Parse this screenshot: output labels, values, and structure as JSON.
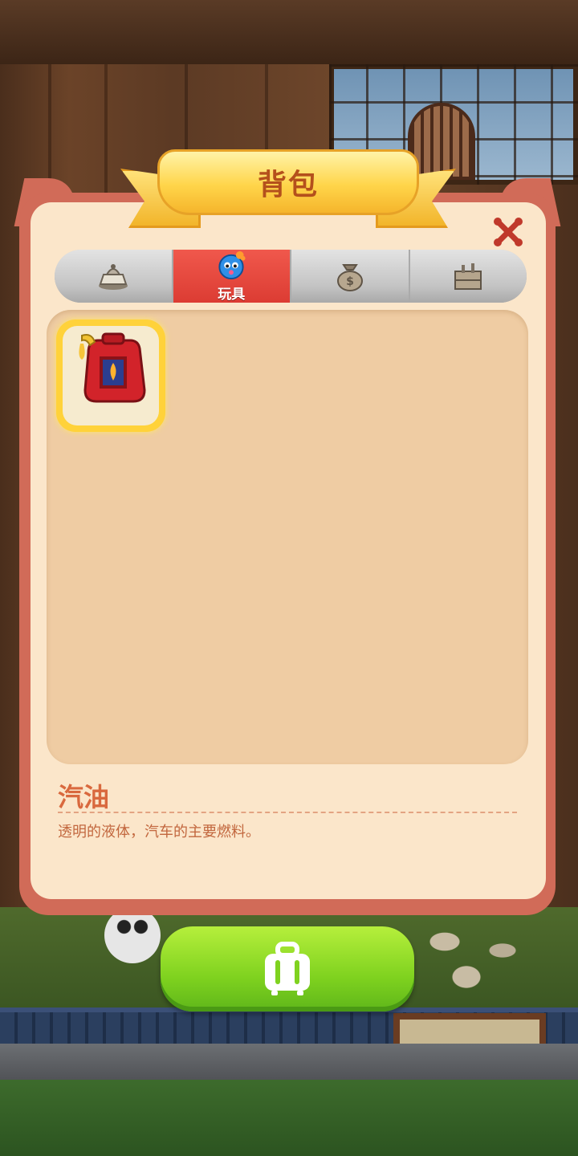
{
  "window": {
    "title": "背包"
  },
  "tabs": [
    {
      "label": "",
      "icon": "cake-icon",
      "active": false
    },
    {
      "label": "玩具",
      "icon": "toy-icon",
      "active": true
    },
    {
      "label": "",
      "icon": "money-bag-icon",
      "active": false
    },
    {
      "label": "",
      "icon": "crate-icon",
      "active": false
    }
  ],
  "inventory": {
    "items": [
      {
        "icon": "fuel-can-icon",
        "selected": true
      }
    ]
  },
  "detail": {
    "name": "汽油",
    "description": "透明的液体，汽车的主要燃料。"
  },
  "buttons": {
    "close_icon": "close-icon",
    "bag_icon": "suitcase-icon"
  },
  "colors": {
    "panel_frame": "#d16b58",
    "panel_bg": "#fbe6ca",
    "active_tab": "#e4463b",
    "title_text": "#b4501c",
    "green_button": "#7fd21f"
  }
}
